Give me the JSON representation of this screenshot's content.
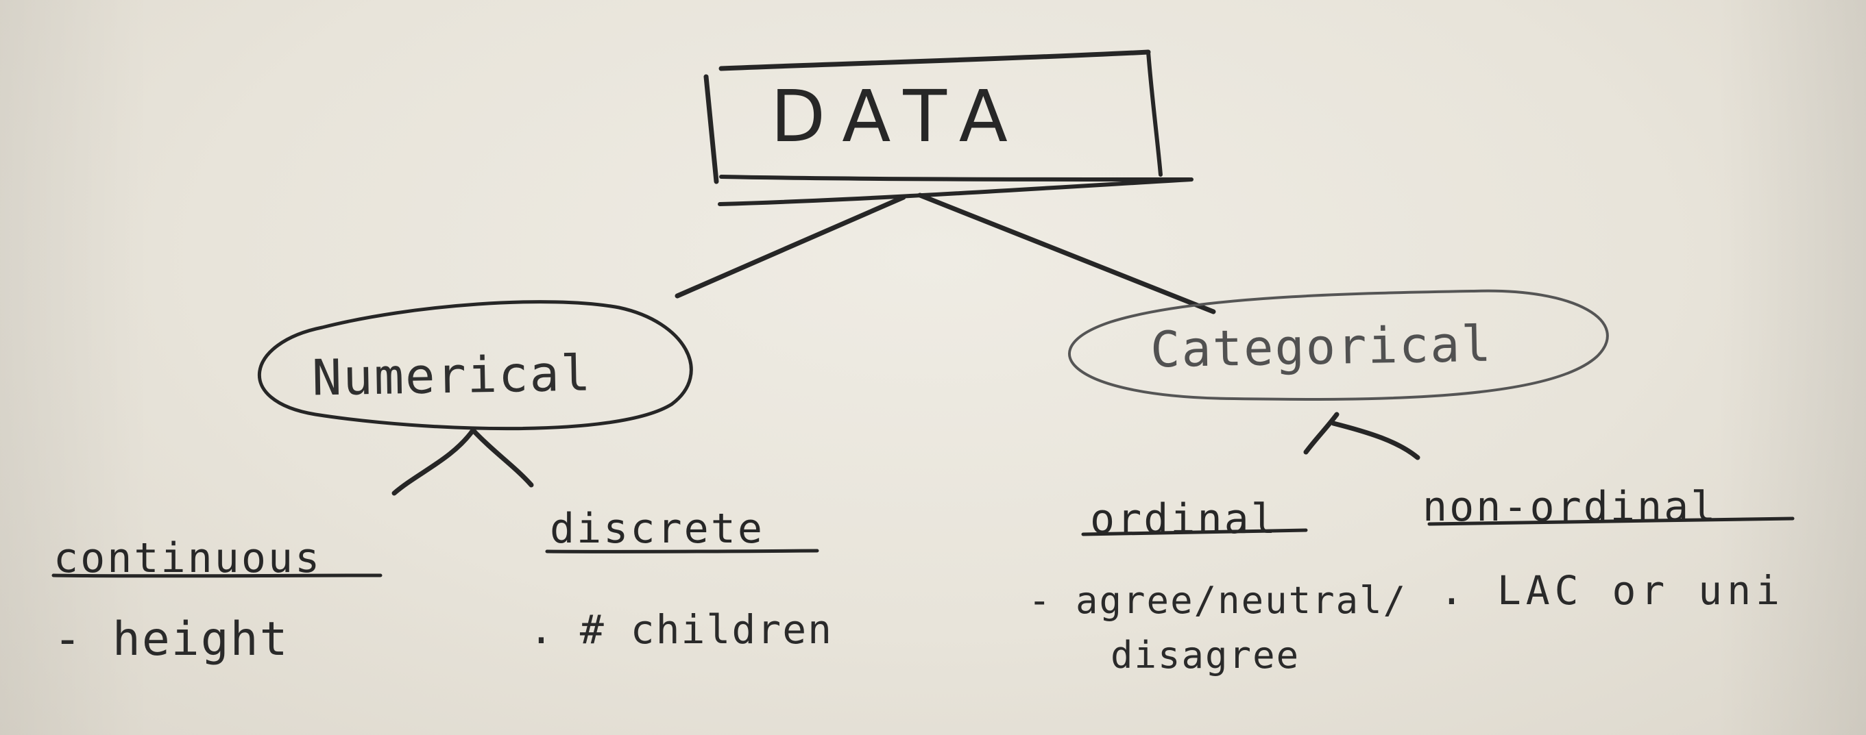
{
  "diagram": {
    "root": {
      "label": "DATA"
    },
    "branches": [
      {
        "label": "Numerical",
        "children": [
          {
            "label": "continuous",
            "example": "- height"
          },
          {
            "label": "discrete",
            "example": ". # children"
          }
        ]
      },
      {
        "label": "Categorical",
        "children": [
          {
            "label": "ordinal",
            "example_line1": "- agree/neutral/",
            "example_line2": "disagree"
          },
          {
            "label": "non-ordinal",
            "example": ". LAC or uni"
          }
        ]
      }
    ]
  }
}
